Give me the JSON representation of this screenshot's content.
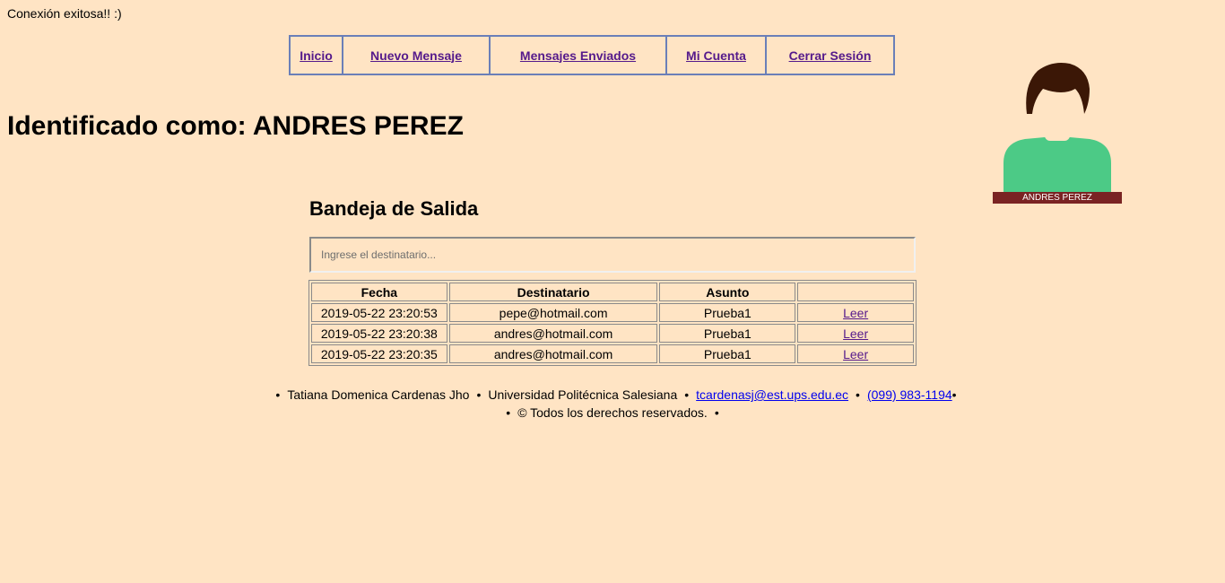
{
  "status_message": "Conexión exitosa!! :)",
  "nav": [
    {
      "label": "Inicio"
    },
    {
      "label": "Nuevo Mensaje"
    },
    {
      "label": "Mensajes Enviados"
    },
    {
      "label": "Mi Cuenta"
    },
    {
      "label": "Cerrar Sesión"
    }
  ],
  "identity": {
    "heading": "Identificado como: ANDRES PEREZ"
  },
  "avatar": {
    "icon": "user-avatar-icon",
    "name": "ANDRES PEREZ"
  },
  "outbox": {
    "title": "Bandeja de Salida",
    "search_placeholder": "Ingrese el destinatario...",
    "columns": [
      "Fecha",
      "Destinatario",
      "Asunto",
      ""
    ],
    "rows": [
      {
        "fecha": "2019-05-22 23:20:53",
        "destinatario": "pepe@hotmail.com",
        "asunto": "Prueba1",
        "action": "Leer"
      },
      {
        "fecha": "2019-05-22 23:20:38",
        "destinatario": "andres@hotmail.com",
        "asunto": "Prueba1",
        "action": "Leer"
      },
      {
        "fecha": "2019-05-22 23:20:35",
        "destinatario": "andres@hotmail.com",
        "asunto": "Prueba1",
        "action": "Leer"
      }
    ]
  },
  "footer": {
    "bullet": "•",
    "author": "Tatiana Domenica Cardenas Jho",
    "university": "Universidad Politécnica Salesiana",
    "email": "tcardenasj@est.ups.edu.ec",
    "phone": "(099) 983-1194",
    "copyright": "© Todos los derechos reservados."
  },
  "colors": {
    "background": "#ffe4c4",
    "nav_border": "#6a7fb8",
    "link_visited": "#551a8b",
    "link": "#0000ee",
    "avatar_shirt": "#4cca86",
    "avatar_hair": "#3b1706",
    "avatar_label_bg": "#7a2323"
  }
}
